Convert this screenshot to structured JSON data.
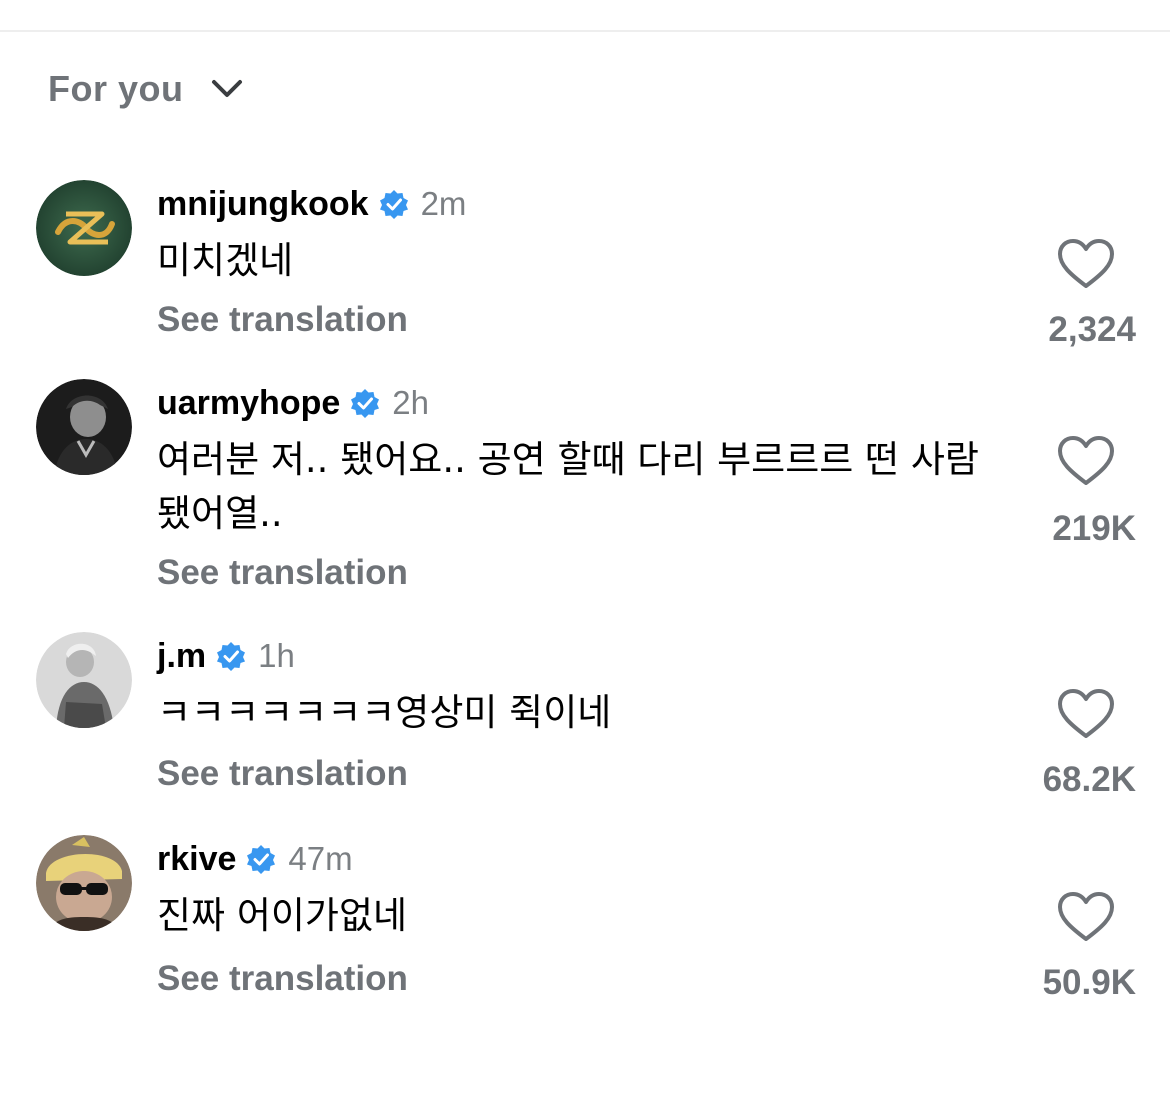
{
  "sort": {
    "label": "For you"
  },
  "comments": [
    {
      "username": "mnijungkook",
      "time": "2m",
      "text": "미치겠네",
      "translate_label": "See translation",
      "likes": "2,324",
      "verified": true
    },
    {
      "username": "uarmyhope",
      "time": "2h",
      "text": "여러분 저.. 됐어요.. 공연 할때 다리 부르르르 떤 사람 됐어열..",
      "translate_label": "See translation",
      "likes": "219K",
      "verified": true
    },
    {
      "username": "j.m",
      "time": "1h",
      "text": "ㅋㅋㅋㅋㅋㅋㅋ영상미 쥑이네",
      "translate_label": "See translation",
      "likes": "68.2K",
      "verified": true
    },
    {
      "username": "rkive",
      "time": "47m",
      "text": "진짜 어이가없네",
      "translate_label": "See translation",
      "likes": "50.9K",
      "verified": true
    }
  ],
  "colors": {
    "verified": "#3897f0",
    "muted": "#6f7378"
  },
  "icons": {
    "sort": "chevron-down-icon",
    "like": "heart-outline-icon",
    "verified": "verified-badge-icon"
  }
}
